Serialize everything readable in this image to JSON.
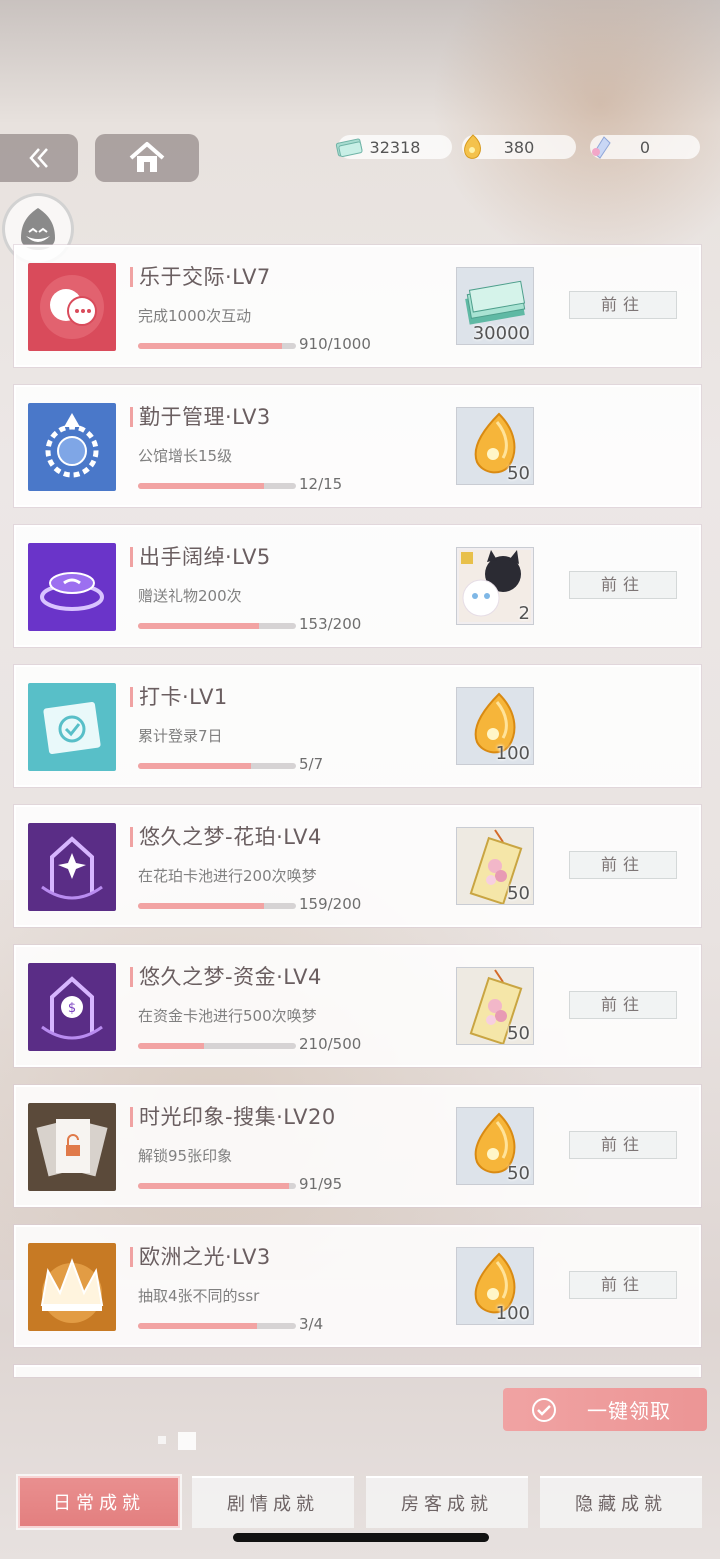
{
  "currencies": [
    {
      "icon": "banknote-icon",
      "value": "32318"
    },
    {
      "icon": "amber-gem-icon",
      "value": "380"
    },
    {
      "icon": "crystal-icon",
      "value": "0"
    }
  ],
  "achievements": [
    {
      "title": "乐于交际·LV7",
      "desc": "完成1000次互动",
      "progress_text": "910/1000",
      "progress": 0.91,
      "reward_icon": "banknote-stack-icon",
      "reward_count": "30000",
      "action": "前往"
    },
    {
      "title": "勤于管理·LV3",
      "desc": "公馆增长15级",
      "progress_text": "12/15",
      "progress": 0.8,
      "reward_icon": "amber-gem-icon",
      "reward_count": "50",
      "action": ""
    },
    {
      "title": "出手阔绰·LV5",
      "desc": "赠送礼物200次",
      "progress_text": "153/200",
      "progress": 0.765,
      "reward_icon": "cat-card-icon",
      "reward_count": "2",
      "action": "前往"
    },
    {
      "title": "打卡·LV1",
      "desc": "累计登录7日",
      "progress_text": "5/7",
      "progress": 0.714,
      "reward_icon": "amber-gem-icon",
      "reward_count": "100",
      "action": ""
    },
    {
      "title": "悠久之梦-花珀·LV4",
      "desc": "在花珀卡池进行200次唤梦",
      "progress_text": "159/200",
      "progress": 0.795,
      "reward_icon": "floral-ticket-icon",
      "reward_count": "50",
      "action": "前往"
    },
    {
      "title": "悠久之梦-资金·LV4",
      "desc": "在资金卡池进行500次唤梦",
      "progress_text": "210/500",
      "progress": 0.42,
      "reward_icon": "floral-ticket-icon",
      "reward_count": "50",
      "action": "前往"
    },
    {
      "title": "时光印象-搜集·LV20",
      "desc": "解锁95张印象",
      "progress_text": "91/95",
      "progress": 0.958,
      "reward_icon": "amber-gem-icon",
      "reward_count": "50",
      "action": "前往"
    },
    {
      "title": "欧洲之光·LV3",
      "desc": "抽取4张不同的ssr",
      "progress_text": "3/4",
      "progress": 0.75,
      "reward_icon": "amber-gem-icon",
      "reward_count": "100",
      "action": "前往"
    }
  ],
  "claim_all_label": "一键领取",
  "tabs": [
    {
      "label": "日常成就",
      "active": true
    },
    {
      "label": "剧情成就",
      "active": false
    },
    {
      "label": "房客成就",
      "active": false
    },
    {
      "label": "隐藏成就",
      "active": false
    }
  ]
}
